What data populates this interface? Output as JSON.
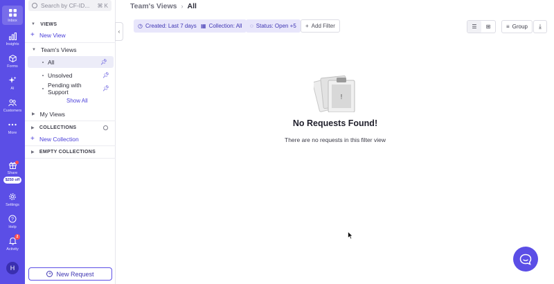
{
  "rail": {
    "items": [
      {
        "label": "Inbox",
        "icon": "grid-icon"
      },
      {
        "label": "Insights",
        "icon": "bar-chart-icon"
      },
      {
        "label": "Forms",
        "icon": "cube-icon"
      },
      {
        "label": "AI",
        "icon": "sparkle-icon"
      },
      {
        "label": "Customers",
        "icon": "people-icon"
      },
      {
        "label": "More",
        "icon": "dots-icon"
      },
      {
        "label": "Share",
        "icon": "gift-icon"
      },
      {
        "label": "Settings",
        "icon": "gear-icon"
      },
      {
        "label": "Help",
        "icon": "help-icon"
      },
      {
        "label": "Activity",
        "icon": "bell-icon"
      }
    ],
    "promo": "$250 off",
    "activity_badge": "2",
    "avatar": "H",
    "accent": "#5b4ee6"
  },
  "sidebar": {
    "search_placeholder": "Search by CF-ID...",
    "search_shortcut": "⌘ K",
    "views_header": "VIEWS",
    "new_view": "New View",
    "teams_views": "Team's Views",
    "team_items": [
      {
        "label": "All",
        "pinned": true
      },
      {
        "label": "Unsolved",
        "pinned": true
      },
      {
        "label": "Pending with Support",
        "pinned": true
      }
    ],
    "show_all": "Show All",
    "my_views": "My Views",
    "collections_header": "COLLECTIONS",
    "new_collection": "New Collection",
    "empty_collections": "EMPTY COLLECTIONS",
    "new_request": "New Request"
  },
  "header": {
    "crumb_parent": "Team's Views",
    "crumb_current": "All"
  },
  "filters": {
    "created": "Created: Last 7 days",
    "collection": "Collection: All",
    "status": "Status: Open +5",
    "add_filter": "Add Filter"
  },
  "toolbar": {
    "group": "Group"
  },
  "empty_state": {
    "title": "No Requests Found!",
    "subtitle": "There are no requests in this filter view"
  }
}
